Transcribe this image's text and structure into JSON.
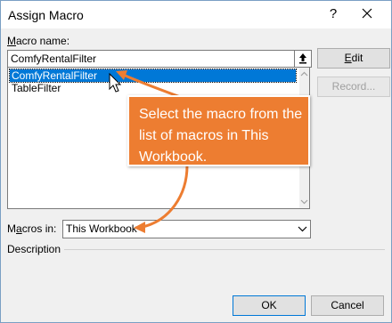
{
  "dialog": {
    "title": "Assign Macro",
    "help_glyph": "?",
    "close_icon": "close-icon"
  },
  "macro_name": {
    "label_prefix": "",
    "label_mnemonic": "M",
    "label_rest": "acro name:",
    "value": "ComfyRentalFilter"
  },
  "macro_list": {
    "items": [
      "ComfyRentalFilter",
      "TableFilter"
    ],
    "selected_index": 0
  },
  "buttons": {
    "edit_mnemonic": "E",
    "edit_rest": "dit",
    "record": "Record...",
    "ok": "OK",
    "cancel": "Cancel"
  },
  "macros_in": {
    "label_prefix": "M",
    "label_mnemonic": "a",
    "label_rest": "cros in:",
    "value": "This Workbook"
  },
  "description": {
    "label": "Description"
  },
  "callout": {
    "text": "Select the macro from the list of macros in This Workbook.",
    "color": "#ed7d31"
  },
  "colors": {
    "selection": "#0078d7",
    "window_bg": "#f0f0f0"
  }
}
